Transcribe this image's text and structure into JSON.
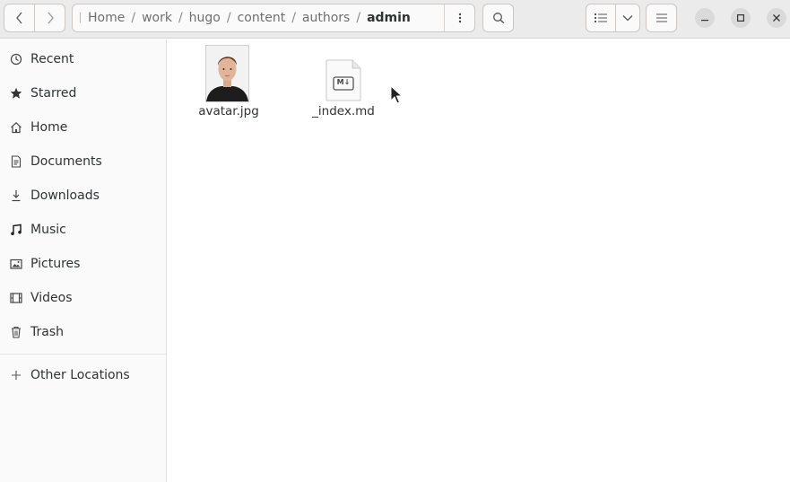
{
  "header": {
    "path": [
      "Home",
      "work",
      "hugo",
      "content",
      "authors",
      "admin"
    ],
    "icons": {
      "back": "chevron-left-icon",
      "forward": "chevron-right-icon",
      "path_menu": "vertical-dots-icon",
      "search": "search-icon",
      "view": "list-view-icon",
      "view_options": "chevron-down-icon",
      "main_menu": "hamburger-menu-icon",
      "minimize": "minimize-icon",
      "maximize": "maximize-icon",
      "close": "close-icon"
    }
  },
  "sidebar": {
    "items": [
      {
        "label": "Recent",
        "icon": "clock-icon"
      },
      {
        "label": "Starred",
        "icon": "star-icon"
      },
      {
        "label": "Home",
        "icon": "home-icon"
      },
      {
        "label": "Documents",
        "icon": "document-icon"
      },
      {
        "label": "Downloads",
        "icon": "download-icon"
      },
      {
        "label": "Music",
        "icon": "music-icon"
      },
      {
        "label": "Pictures",
        "icon": "picture-icon"
      },
      {
        "label": "Videos",
        "icon": "video-icon"
      },
      {
        "label": "Trash",
        "icon": "trash-icon"
      }
    ],
    "other_locations": {
      "label": "Other Locations",
      "icon": "plus-icon"
    }
  },
  "files": [
    {
      "name": "avatar.jpg",
      "icon": "image-thumbnail"
    },
    {
      "name": "_index.md",
      "icon": "markdown-file-icon",
      "badge": "M↓"
    }
  ],
  "colors": {
    "headerbar": "#ebebeb",
    "sidebar": "#fafafa",
    "text": "#2e3436"
  }
}
